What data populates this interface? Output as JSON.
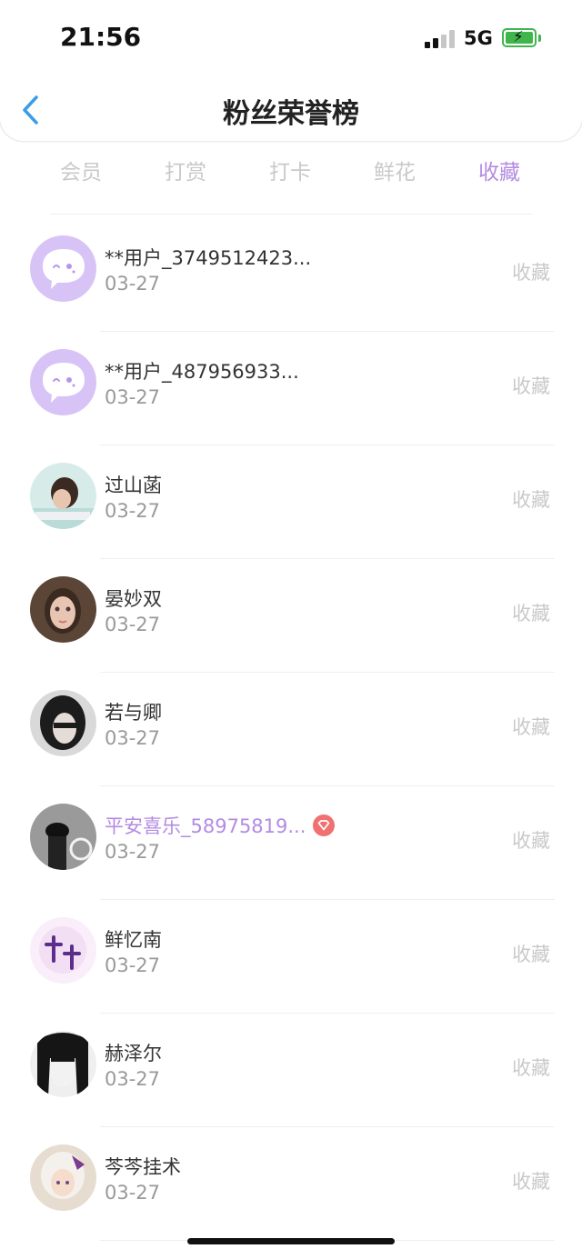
{
  "status": {
    "time": "21:56",
    "network": "5G"
  },
  "header": {
    "title": "粉丝荣誉榜"
  },
  "tabs": [
    {
      "label": "会员",
      "active": false
    },
    {
      "label": "打赏",
      "active": false
    },
    {
      "label": "打卡",
      "active": false
    },
    {
      "label": "鲜花",
      "active": false
    },
    {
      "label": "收藏",
      "active": true
    }
  ],
  "fans": [
    {
      "name": "**用户_3749512423...",
      "date": "03-27",
      "action": "收藏",
      "avatar": "default-bubble",
      "vip": false
    },
    {
      "name": "**用户_487956933...",
      "date": "03-27",
      "action": "收藏",
      "avatar": "default-bubble",
      "vip": false
    },
    {
      "name": "过山菡",
      "date": "03-27",
      "action": "收藏",
      "avatar": "photo",
      "vip": false
    },
    {
      "name": "晏妙双",
      "date": "03-27",
      "action": "收藏",
      "avatar": "photo",
      "vip": false
    },
    {
      "name": "若与卿",
      "date": "03-27",
      "action": "收藏",
      "avatar": "photo",
      "vip": false
    },
    {
      "name": "平安喜乐_58975819...",
      "date": "03-27",
      "action": "收藏",
      "avatar": "photo",
      "vip": true
    },
    {
      "name": "鲜忆南",
      "date": "03-27",
      "action": "收藏",
      "avatar": "photo",
      "vip": false
    },
    {
      "name": "赫泽尔",
      "date": "03-27",
      "action": "收藏",
      "avatar": "photo",
      "vip": false
    },
    {
      "name": "芩芩挂术",
      "date": "03-27",
      "action": "收藏",
      "avatar": "photo",
      "vip": false
    }
  ],
  "colors": {
    "accent": "#b48be2",
    "inactive_tab": "#c9c9c9",
    "battery": "#3fb54b",
    "vip_badge": "#f0716f",
    "back_arrow": "#3a9de8"
  }
}
